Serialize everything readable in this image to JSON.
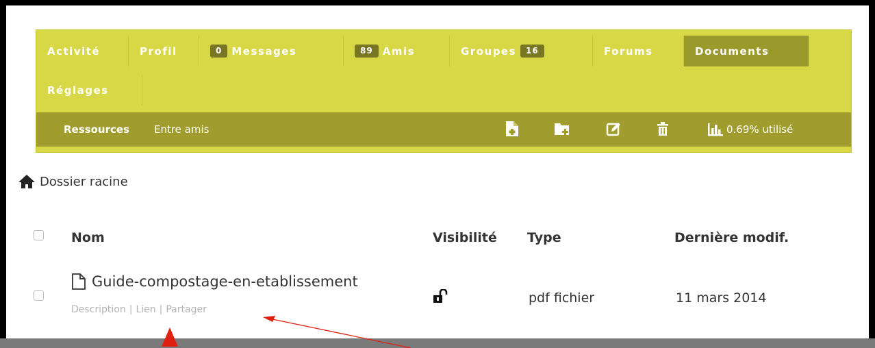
{
  "tabs": [
    {
      "label": "Activité",
      "badge": ""
    },
    {
      "label": "Profil",
      "badge": ""
    },
    {
      "label": "Messages",
      "badge": "0"
    },
    {
      "label": "Amis",
      "badge": "89"
    },
    {
      "label": "Groupes",
      "badge": "16"
    },
    {
      "label": "Forums",
      "badge": ""
    },
    {
      "label": "Documents",
      "badge": "",
      "active": true
    },
    {
      "label": "Réglages",
      "badge": ""
    }
  ],
  "subnav": {
    "items": [
      "Ressources",
      "Entre amis"
    ],
    "usage": "0.69% utilisé"
  },
  "toolbar_icons": [
    "new-file-icon",
    "new-folder-icon",
    "edit-icon",
    "trash-icon",
    "chart-icon"
  ],
  "breadcrumb": "Dossier racine",
  "table": {
    "headers": {
      "name": "Nom",
      "visibility": "Visibilité",
      "type": "Type",
      "modified": "Dernière modif."
    },
    "rows": [
      {
        "name": "Guide-compostage-en-etablissement",
        "visibility_icon": "unlocked-icon",
        "type": "pdf fichier",
        "modified": "11 mars 2014",
        "actions": [
          "Description",
          "Lien",
          "Partager"
        ]
      }
    ]
  },
  "colors": {
    "panel": "#d8d746",
    "active_tab": "#9a992c",
    "subbar": "#a09d2e",
    "arrow": "#e02010"
  }
}
